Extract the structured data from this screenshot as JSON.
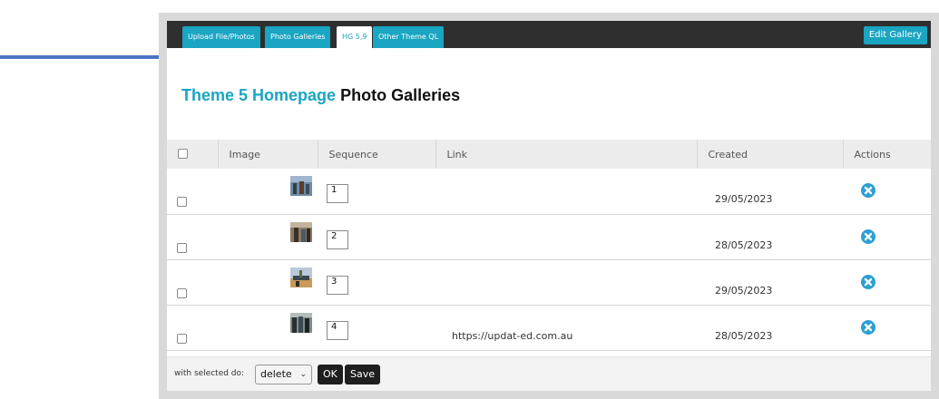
{
  "tabs": [
    {
      "label": "Upload File/Photos"
    },
    {
      "label": "Photo Galleries"
    },
    {
      "label": "HG 5,9"
    },
    {
      "label": "Other Theme QL"
    }
  ],
  "edit_button": "Edit Gallery",
  "title": {
    "accent": "Theme 5 Homepage",
    "main": "Photo Galleries"
  },
  "table": {
    "headers": {
      "image": "Image",
      "sequence": "Sequence",
      "link": "Link",
      "created": "Created",
      "actions": "Actions"
    },
    "rows": [
      {
        "sequence": "1",
        "link": "",
        "created": "29/05/2023"
      },
      {
        "sequence": "2",
        "link": "",
        "created": "28/05/2023"
      },
      {
        "sequence": "3",
        "link": "",
        "created": "29/05/2023"
      },
      {
        "sequence": "4",
        "link": "https://updat-ed.com.au",
        "created": "28/05/2023"
      }
    ]
  },
  "footer": {
    "label": "with selected do:",
    "action_value": "delete",
    "ok_label": "OK",
    "save_label": "Save"
  },
  "colors": {
    "accent": "#1aa5c2",
    "arrow": "#4a76c2",
    "tabbar": "#2f2f2f",
    "delete_icon": "#2d9fd4"
  }
}
